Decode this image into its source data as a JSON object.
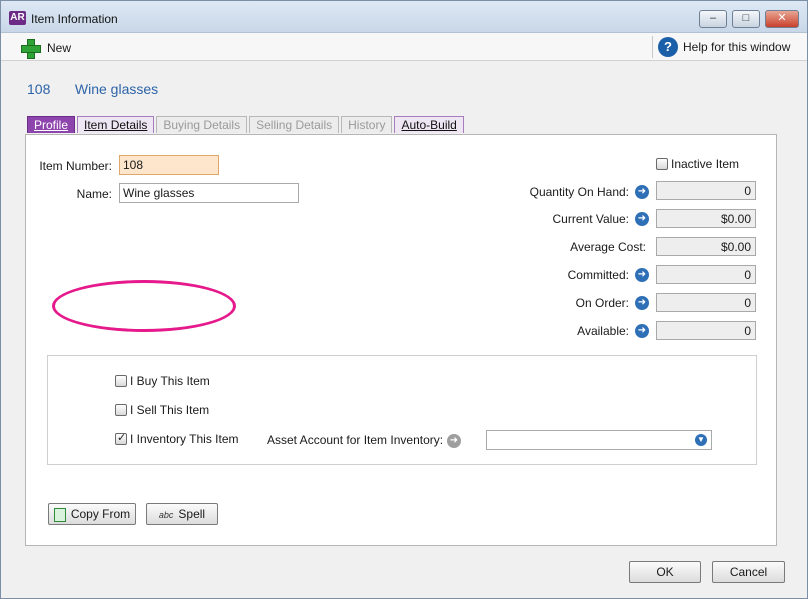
{
  "window": {
    "title": "Item Information",
    "app_logo": "AR"
  },
  "title_buttons": {
    "minimize": "–",
    "maximize": "□",
    "close": "✕"
  },
  "toolbar": {
    "new_label": "New",
    "help_label": "Help for this window",
    "help_glyph": "?"
  },
  "record": {
    "number": "108",
    "name": "Wine glasses"
  },
  "tabs": [
    {
      "label": "Profile",
      "state": "active"
    },
    {
      "label": "Item Details",
      "state": "enabled"
    },
    {
      "label": "Buying Details",
      "state": "disabled"
    },
    {
      "label": "Selling Details",
      "state": "disabled"
    },
    {
      "label": "History",
      "state": "disabled"
    },
    {
      "label": "Auto-Build",
      "state": "enabled"
    }
  ],
  "profile": {
    "item_number_label": "Item Number:",
    "item_number_value": "108",
    "name_label": "Name:",
    "name_value": "Wine glasses",
    "inactive_label": "Inactive Item",
    "inactive_checked": false,
    "stats": [
      {
        "label": "Quantity On Hand:",
        "value": "0",
        "has_link": true
      },
      {
        "label": "Current Value:",
        "value": "$0.00",
        "has_link": true
      },
      {
        "label": "Average Cost:",
        "value": "$0.00",
        "has_link": false
      },
      {
        "label": "Committed:",
        "value": "0",
        "has_link": true
      },
      {
        "label": "On Order:",
        "value": "0",
        "has_link": true
      },
      {
        "label": "Available:",
        "value": "0",
        "has_link": true
      }
    ],
    "checkboxes": [
      {
        "label": "I Buy This Item",
        "checked": false
      },
      {
        "label": "I Sell This Item",
        "checked": false
      },
      {
        "label": "I Inventory This Item",
        "checked": true
      }
    ],
    "asset_account_label": "Asset Account for Item Inventory:",
    "asset_account_value": ""
  },
  "buttons": {
    "copy_from": "Copy From",
    "spell": "Spell",
    "spell_icon_text": "abc",
    "ok": "OK",
    "cancel": "Cancel"
  },
  "colors": {
    "accent": "#8e44ad",
    "highlight_ring": "#e5198b",
    "link_blue": "#2d63a8"
  }
}
